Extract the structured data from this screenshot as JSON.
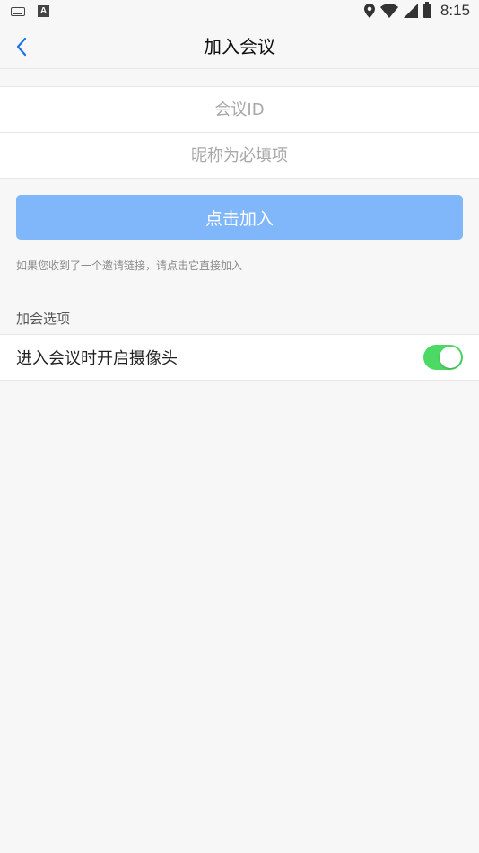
{
  "status_bar": {
    "time": "8:15",
    "left_icons": [
      "keyboard-icon",
      "a-icon"
    ],
    "right_icons": [
      "location-icon",
      "wifi-icon",
      "signal-icon",
      "battery-icon"
    ],
    "a_glyph": "A"
  },
  "nav": {
    "title": "加入会议",
    "back_icon": "chevron-left-icon"
  },
  "form": {
    "meeting_id": {
      "value": "",
      "placeholder": "会议ID"
    },
    "nickname": {
      "value": "",
      "placeholder": "昵称为必填项"
    }
  },
  "join_button": {
    "label": "点击加入",
    "color": "#80b7fb"
  },
  "hint": "如果您收到了一个邀请链接，请点击它直接加入",
  "options": {
    "section_title": "加会选项",
    "items": [
      {
        "label": "进入会议时开启摄像头",
        "enabled": true
      }
    ]
  },
  "colors": {
    "accent": "#1a73e8",
    "toggle_on": "#4cd964",
    "background": "#f7f7f7"
  }
}
